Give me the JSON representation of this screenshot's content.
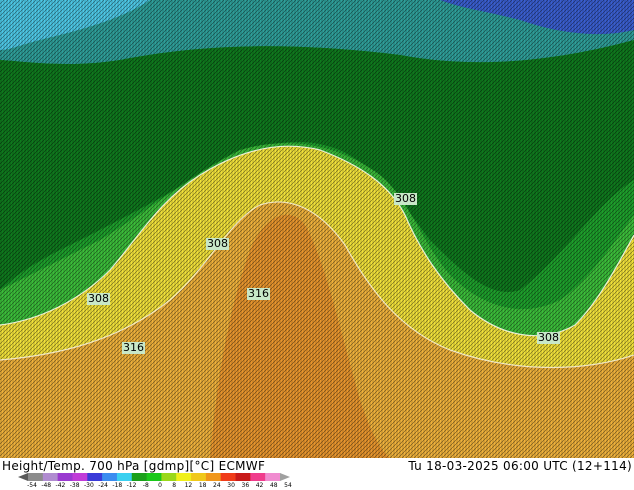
{
  "map": {
    "contour_labels": [
      "308",
      "308",
      "308",
      "316",
      "316",
      "308"
    ],
    "colors": {
      "cyan": "#4ec8e6",
      "blue": "#3a5fd0",
      "teal": "#2f9f9a",
      "dark_green": "#0f7a1e",
      "green": "#1ea02c",
      "light_green": "#3cbe3a",
      "yellow": "#f2e23a",
      "light_orange": "#f0b23c",
      "orange": "#e8962e"
    }
  },
  "footer": {
    "title": "Height/Temp. 700 hPa [gdmp][°C] ECMWF",
    "datetime": "Tu 18-03-2025 06:00 UTC (12+114)"
  },
  "colorbar": {
    "ticks": [
      "-54",
      "-48",
      "-42",
      "-38",
      "-30",
      "-24",
      "-18",
      "-12",
      "-8",
      "0",
      "8",
      "12",
      "18",
      "24",
      "30",
      "36",
      "42",
      "48",
      "54"
    ],
    "colors": [
      "#5a5a5a",
      "#8c8c8c",
      "#b08cd0",
      "#9a3ad0",
      "#c03cd8",
      "#3a3ad8",
      "#3a8cf0",
      "#3ad0f0",
      "#1aa01a",
      "#1ac81a",
      "#9ad81a",
      "#f0f01a",
      "#f0c81a",
      "#f0961a",
      "#f03c1a",
      "#c81a1a",
      "#f03c8c",
      "#f08cd0",
      "#a0a0a0"
    ]
  }
}
